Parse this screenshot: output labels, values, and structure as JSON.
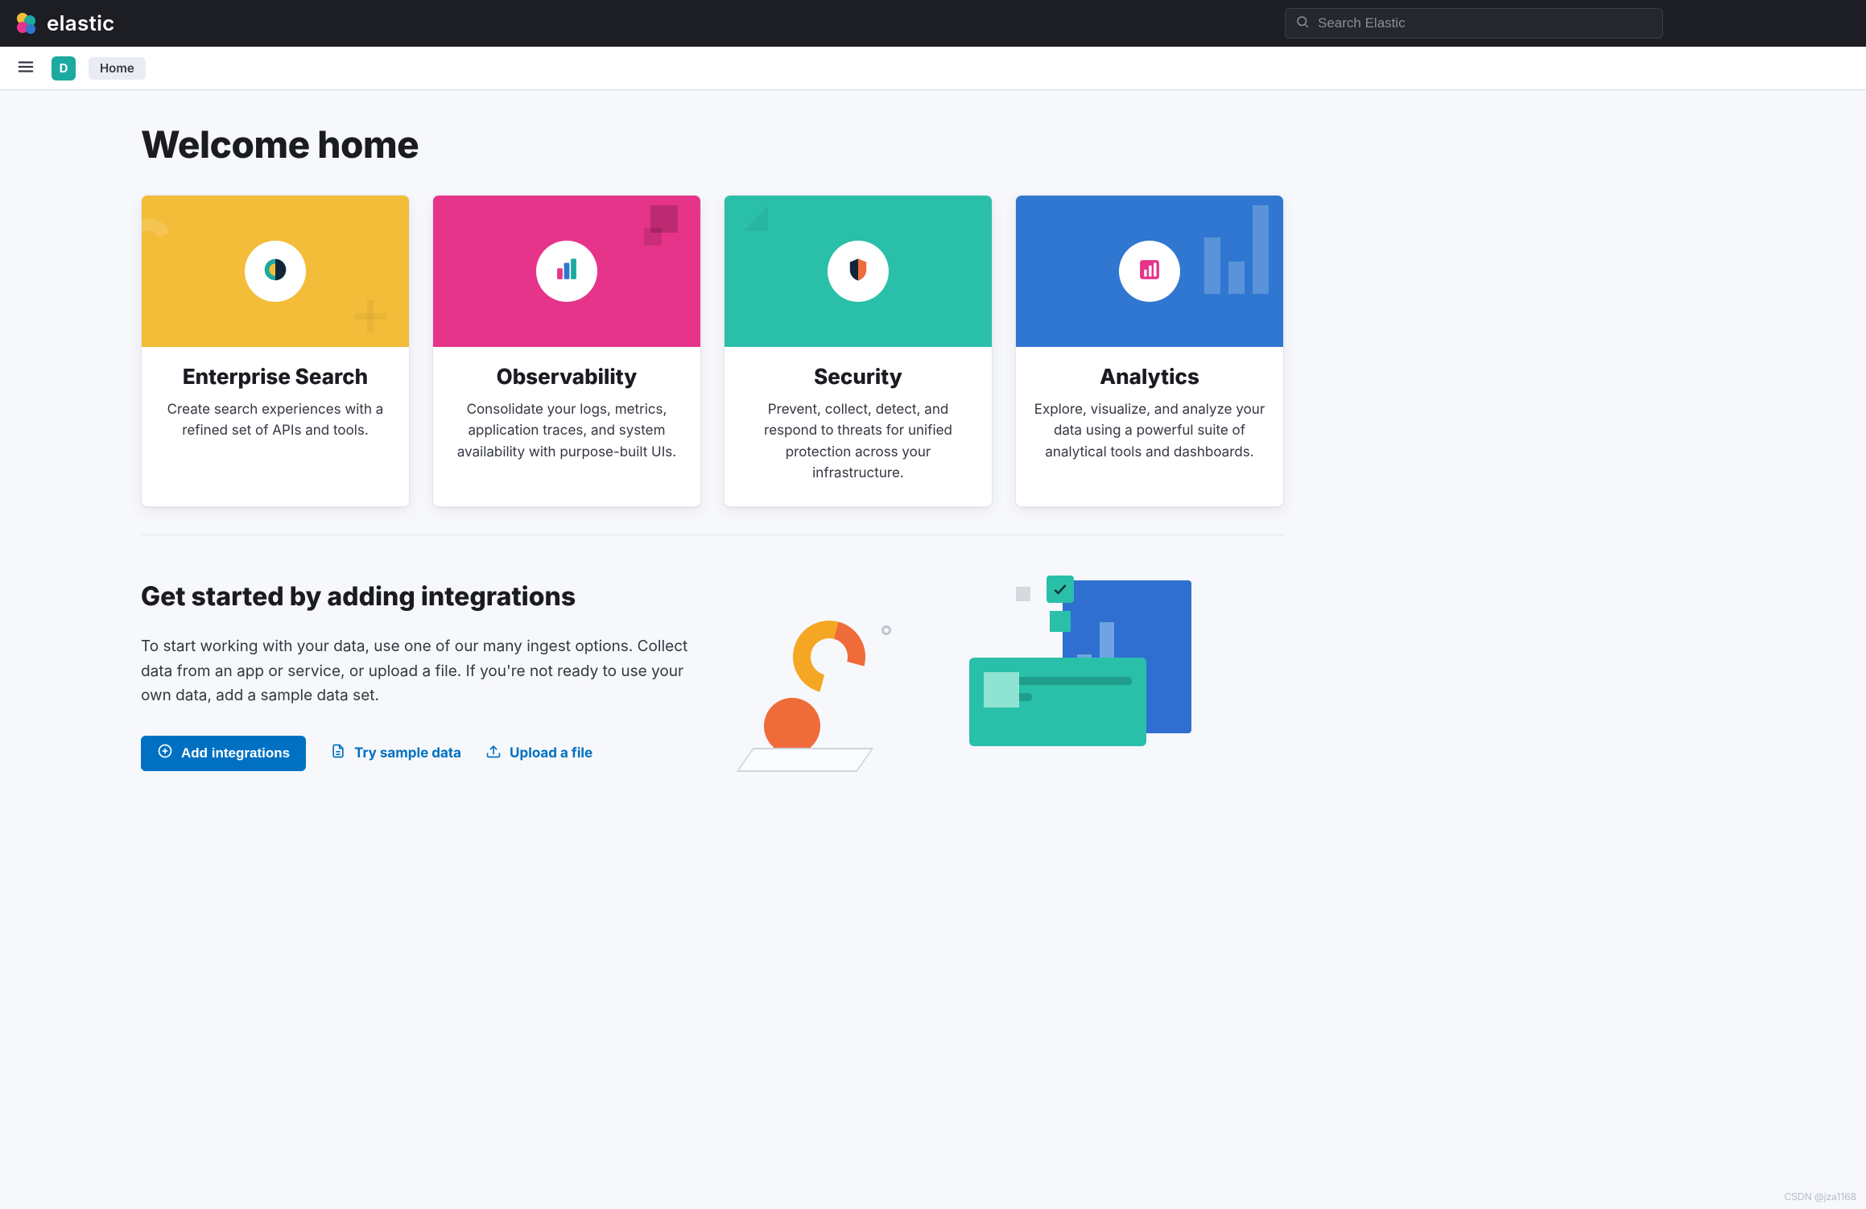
{
  "header": {
    "wordmark": "elastic",
    "search_placeholder": "Search Elastic"
  },
  "subheader": {
    "space_letter": "D",
    "breadcrumb": "Home"
  },
  "page": {
    "title": "Welcome home"
  },
  "solutions": [
    {
      "id": "enterprise-search",
      "hero": "yellow",
      "title": "Enterprise Search",
      "desc": "Create search experiences with a refined set of APIs and tools."
    },
    {
      "id": "observability",
      "hero": "pink",
      "title": "Observability",
      "desc": "Consolidate your logs, metrics, application traces, and system availability with purpose-built UIs."
    },
    {
      "id": "security",
      "hero": "teal",
      "title": "Security",
      "desc": "Prevent, collect, detect, and respond to threats for unified protection across your infrastructure."
    },
    {
      "id": "analytics",
      "hero": "blue",
      "title": "Analytics",
      "desc": "Explore, visualize, and analyze your data using a powerful suite of analytical tools and dashboards."
    }
  ],
  "getstarted": {
    "heading": "Get started by adding integrations",
    "desc": "To start working with your data, use one of our many ingest options. Collect data from an app or service, or upload a file. If you're not ready to use your own data, add a sample data set.",
    "add_integrations": "Add integrations",
    "try_sample": "Try sample data",
    "upload_file": "Upload a file"
  },
  "watermark": "CSDN @jza1168"
}
